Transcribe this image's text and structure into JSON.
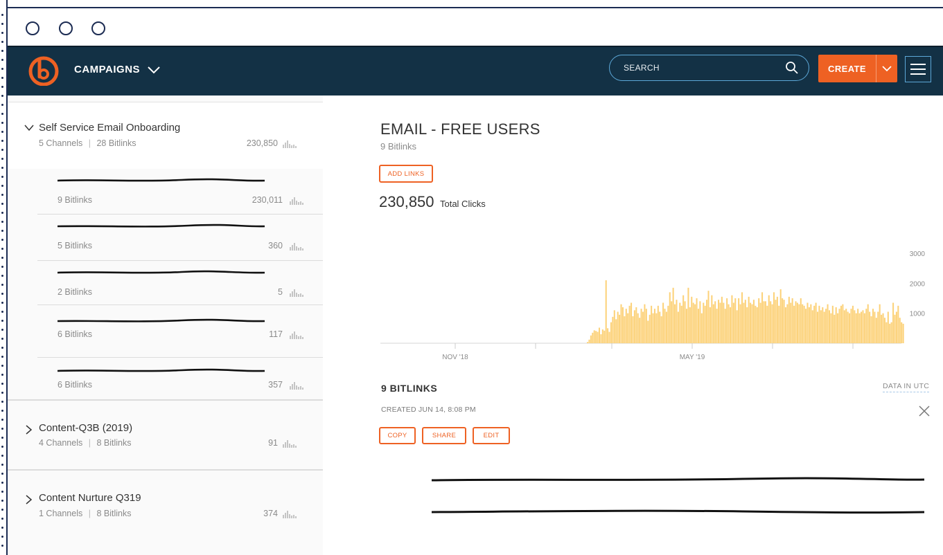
{
  "header": {
    "menu_label": "CAMPAIGNS",
    "search_placeholder": "SEARCH",
    "create_label": "CREATE",
    "accent_color": "#ee6123",
    "header_color": "#133145"
  },
  "sidebar": {
    "campaigns": [
      {
        "title": "Self Service Email Onboarding",
        "meta_channels": "5 Channels",
        "meta_bitlinks": "28 Bitlinks",
        "count": "230,850",
        "expanded": true,
        "channels": [
          {
            "label": "9 Bitlinks",
            "count": "230,011"
          },
          {
            "label": "5 Bitlinks",
            "count": "360"
          },
          {
            "label": "2 Bitlinks",
            "count": "5"
          },
          {
            "label": "6 Bitlinks",
            "count": "117"
          },
          {
            "label": "6 Bitlinks",
            "count": "357"
          }
        ]
      },
      {
        "title": "Content-Q3B (2019)",
        "meta_channels": "4 Channels",
        "meta_bitlinks": "8 Bitlinks",
        "count": "91",
        "expanded": false
      },
      {
        "title": "Content Nurture Q319",
        "meta_channels": "1 Channels",
        "meta_bitlinks": "8 Bitlinks",
        "count": "374",
        "expanded": false
      }
    ]
  },
  "main": {
    "title": "EMAIL - FREE USERS",
    "subtitle": "9 Bitlinks",
    "add_links_label": "ADD LINKS",
    "total_value": "230,850",
    "total_label": "Total Clicks",
    "bitlinks_heading": "9 BITLINKS",
    "data_utc_label": "DATA IN UTC",
    "created_label": "CREATED JUN 14, 8:08 PM",
    "buttons": {
      "copy": "COPY",
      "share": "SHARE",
      "edit": "EDIT"
    }
  },
  "chart_data": {
    "type": "bar",
    "title": "",
    "xlabel": "",
    "ylabel": "",
    "x_tick_labels": [
      "NOV '18",
      "MAY '19"
    ],
    "y_tick_labels": [
      "3000",
      "2000",
      "1000"
    ],
    "ylim": [
      0,
      3000
    ],
    "bar_color": "#fcd27a",
    "grid": false,
    "description_of_series": "daily clicks",
    "values": [
      40,
      120,
      260,
      350,
      430,
      410,
      380,
      520,
      300,
      460,
      420,
      2100,
      500,
      380,
      700,
      880,
      1100,
      800,
      1050,
      950,
      1300,
      1200,
      900,
      1150,
      1000,
      1250,
      1350,
      900,
      1100,
      1200,
      1000,
      850,
      1150,
      1050,
      1300,
      1150,
      750,
      950,
      1250,
      1000,
      1150,
      1000,
      1250,
      1050,
      900,
      1350,
      1150,
      1050,
      1250,
      1700,
      1400,
      1850,
      1300,
      1450,
      1050,
      1350,
      1250,
      1600,
      1400,
      1150,
      1850,
      1200,
      1550,
      1350,
      1300,
      1500,
      1150,
      1400,
      1000,
      1350,
      1250,
      1450,
      1750,
      1200,
      1600,
      1300,
      1400,
      1150,
      1450,
      1350,
      1550,
      1350,
      1150,
      1500,
      1300,
      1200,
      1600,
      1350,
      1500,
      1100,
      1500,
      1300,
      1700,
      1350,
      1450,
      1200,
      1550,
      1350,
      1300,
      1450,
      1250,
      1200,
      1500,
      1350,
      1700,
      1400,
      1400,
      1250,
      1600,
      1400,
      1300,
      1700,
      1450,
      1550,
      1250,
      1800,
      1500,
      1450,
      1200,
      1300,
      1550,
      1350,
      1500,
      1250,
      1400,
      1350,
      1300,
      1500,
      1300,
      1250,
      1150,
      1350,
      1200,
      1300,
      1100,
      1250,
      1350,
      1050,
      1250,
      1100,
      1200,
      1050,
      1150,
      1300,
      1100,
      1000,
      1250,
      950,
      1200,
      1000,
      1150,
      1250,
      1300,
      1100,
      1150,
      1050,
      1000,
      1150,
      1250,
      1100,
      1000,
      1150,
      1000,
      1050,
      1100,
      1000,
      1150,
      1300,
      1050,
      900,
      1150,
      1050,
      850,
      1050,
      1300,
      950,
      1000,
      850,
      700,
      1050,
      650,
      700,
      1350,
      950,
      1050,
      1250,
      850,
      700,
      650
    ]
  }
}
